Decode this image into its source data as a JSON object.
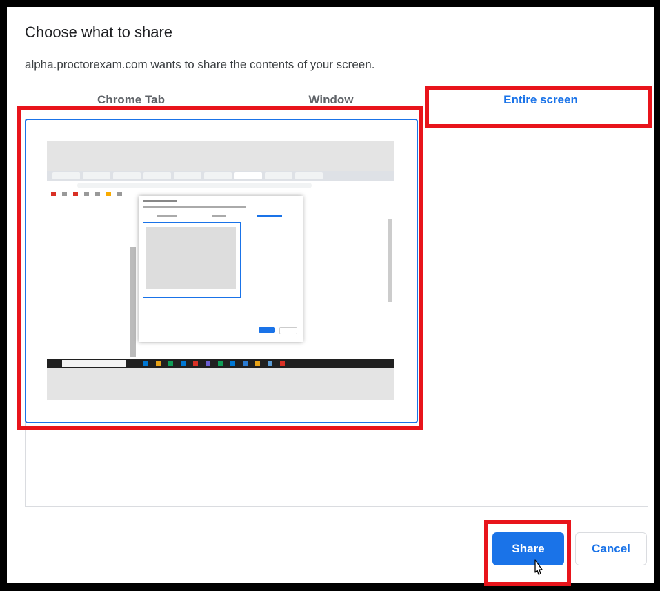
{
  "dialog": {
    "title": "Choose what to share",
    "subtitle": "alpha.proctorexam.com wants to share the contents of your screen."
  },
  "tabs": [
    {
      "label": "Chrome Tab",
      "active": false
    },
    {
      "label": "Window",
      "active": false
    },
    {
      "label": "Entire screen",
      "active": true
    }
  ],
  "selected_source": "Entire screen",
  "buttons": {
    "share_label": "Share",
    "cancel_label": "Cancel"
  },
  "colors": {
    "accent": "#1a73e8",
    "highlight_annotation": "#e8141b"
  },
  "icons": [
    "mouse-pointer-icon"
  ]
}
